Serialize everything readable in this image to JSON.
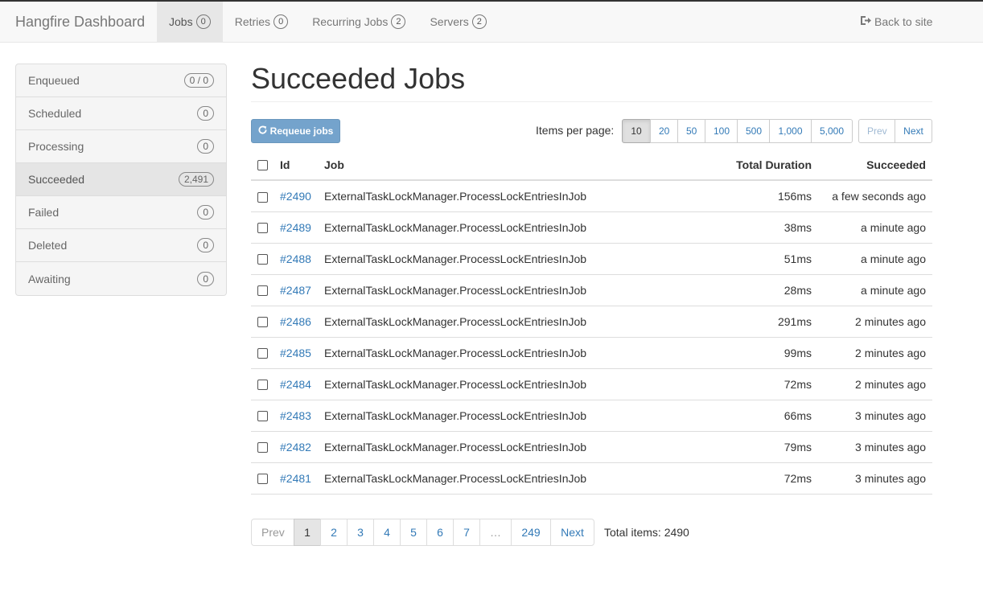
{
  "navbar": {
    "brand": "Hangfire Dashboard",
    "items": [
      {
        "label": "Jobs",
        "badge": "0"
      },
      {
        "label": "Retries",
        "badge": "0"
      },
      {
        "label": "Recurring Jobs",
        "badge": "2"
      },
      {
        "label": "Servers",
        "badge": "2"
      }
    ],
    "back_label": "Back to site"
  },
  "sidebar": {
    "items": [
      {
        "label": "Enqueued",
        "count": "0 / 0"
      },
      {
        "label": "Scheduled",
        "count": "0"
      },
      {
        "label": "Processing",
        "count": "0"
      },
      {
        "label": "Succeeded",
        "count": "2,491"
      },
      {
        "label": "Failed",
        "count": "0"
      },
      {
        "label": "Deleted",
        "count": "0"
      },
      {
        "label": "Awaiting",
        "count": "0"
      }
    ]
  },
  "page": {
    "title": "Succeeded Jobs",
    "requeue_label": "Requeue jobs",
    "items_per_page_label": "Items per page:",
    "per_page_options": [
      "10",
      "20",
      "50",
      "100",
      "500",
      "1,000",
      "5,000"
    ],
    "per_page_selected": "10",
    "prev_label": "Prev",
    "next_label": "Next"
  },
  "table": {
    "headers": {
      "id": "Id",
      "job": "Job",
      "duration": "Total Duration",
      "succeeded": "Succeeded"
    },
    "rows": [
      {
        "id": "#2490",
        "job": "ExternalTaskLockManager.ProcessLockEntriesInJob",
        "duration": "156ms",
        "succeeded": "a few seconds ago"
      },
      {
        "id": "#2489",
        "job": "ExternalTaskLockManager.ProcessLockEntriesInJob",
        "duration": "38ms",
        "succeeded": "a minute ago"
      },
      {
        "id": "#2488",
        "job": "ExternalTaskLockManager.ProcessLockEntriesInJob",
        "duration": "51ms",
        "succeeded": "a minute ago"
      },
      {
        "id": "#2487",
        "job": "ExternalTaskLockManager.ProcessLockEntriesInJob",
        "duration": "28ms",
        "succeeded": "a minute ago"
      },
      {
        "id": "#2486",
        "job": "ExternalTaskLockManager.ProcessLockEntriesInJob",
        "duration": "291ms",
        "succeeded": "2 minutes ago"
      },
      {
        "id": "#2485",
        "job": "ExternalTaskLockManager.ProcessLockEntriesInJob",
        "duration": "99ms",
        "succeeded": "2 minutes ago"
      },
      {
        "id": "#2484",
        "job": "ExternalTaskLockManager.ProcessLockEntriesInJob",
        "duration": "72ms",
        "succeeded": "2 minutes ago"
      },
      {
        "id": "#2483",
        "job": "ExternalTaskLockManager.ProcessLockEntriesInJob",
        "duration": "66ms",
        "succeeded": "3 minutes ago"
      },
      {
        "id": "#2482",
        "job": "ExternalTaskLockManager.ProcessLockEntriesInJob",
        "duration": "79ms",
        "succeeded": "3 minutes ago"
      },
      {
        "id": "#2481",
        "job": "ExternalTaskLockManager.ProcessLockEntriesInJob",
        "duration": "72ms",
        "succeeded": "3 minutes ago"
      }
    ]
  },
  "pagination": {
    "prev_label": "Prev",
    "pages": [
      "1",
      "2",
      "3",
      "4",
      "5",
      "6",
      "7",
      "…",
      "249"
    ],
    "current": "1",
    "next_label": "Next",
    "total_label": "Total items: 2490"
  }
}
